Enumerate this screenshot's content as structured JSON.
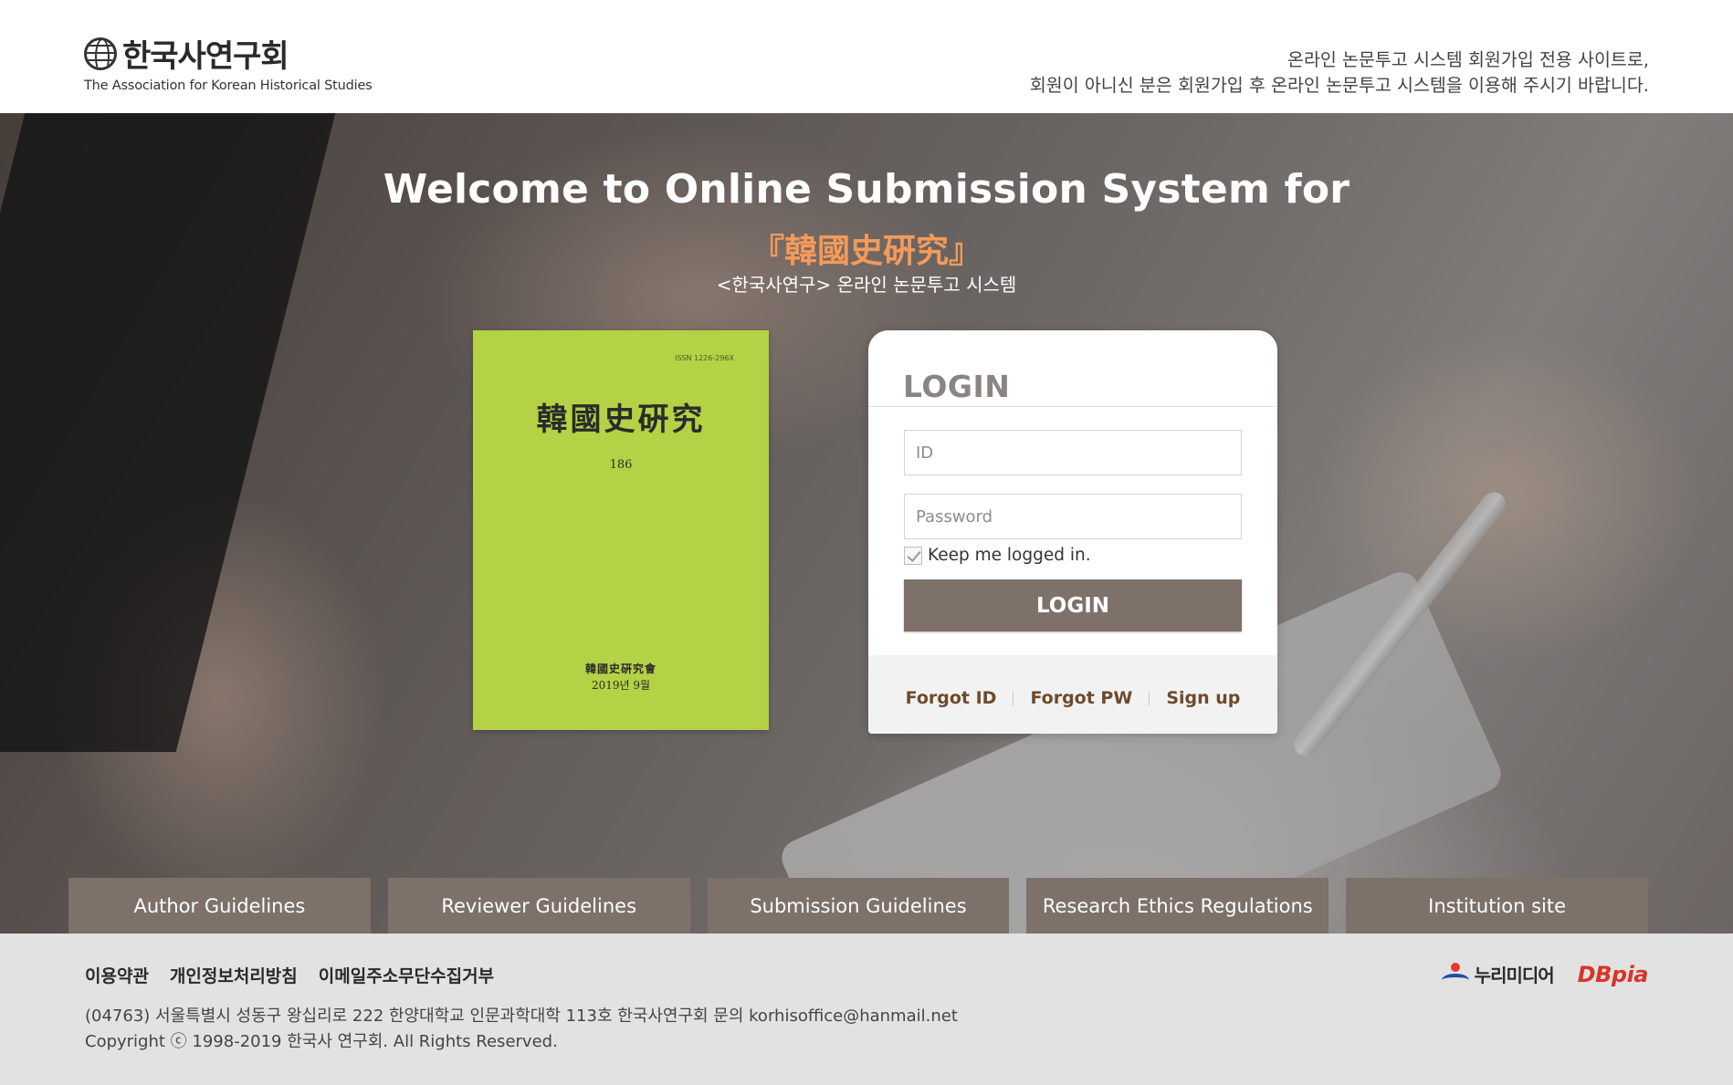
{
  "header": {
    "logo_kr": "한국사연구회",
    "logo_en": "The Association for Korean Historical Studies",
    "notice_line1": "온라인 논문투고 시스템 회원가입 전용 사이트로,",
    "notice_line2": "회원이 아니신 분은 회원가입 후 온라인 논문투고 시스템을 이용해 주시기 바랍니다."
  },
  "hero": {
    "title": "Welcome to Online Submission System for",
    "subtitle": "『韓國史硏究』",
    "subtitle_kr": "<한국사연구> 온라인 논문투고 시스템"
  },
  "cover": {
    "issn": "ISSN 1226-296X",
    "title": "韓國史硏究",
    "volume": "186",
    "publisher": "韓國史硏究會",
    "date": "2019년 9월",
    "color": "#b4d245"
  },
  "login": {
    "title": "LOGIN",
    "id_placeholder": "ID",
    "pw_placeholder": "Password",
    "keep_label": "Keep me logged in.",
    "button_label": "LOGIN",
    "links": {
      "forgot_id": "Forgot ID",
      "forgot_pw": "Forgot PW",
      "signup": "Sign up"
    },
    "button_color": "#7d716a",
    "link_color": "#6e4a2c"
  },
  "tabs": [
    {
      "label": "Author Guidelines"
    },
    {
      "label": "Reviewer Guidelines"
    },
    {
      "label": "Submission Guidelines"
    },
    {
      "label": "Research Ethics Regulations"
    },
    {
      "label": "Institution site"
    }
  ],
  "footer": {
    "links": {
      "terms": "이용약관",
      "privacy": "개인정보처리방침",
      "email_refusal": "이메일주소무단수집거부"
    },
    "address": "(04763) 서울특별시 성동구 왕십리로 222 한양대학교 인문과학대학 113호 한국사연구회 문의 korhisoffice@hanmail.net",
    "copyright": "Copyright ⓒ 1998-2019 한국사 연구회. All Rights Reserved.",
    "partners": {
      "nurimedia": "누리미디어",
      "dbpia": "DBpia"
    }
  }
}
